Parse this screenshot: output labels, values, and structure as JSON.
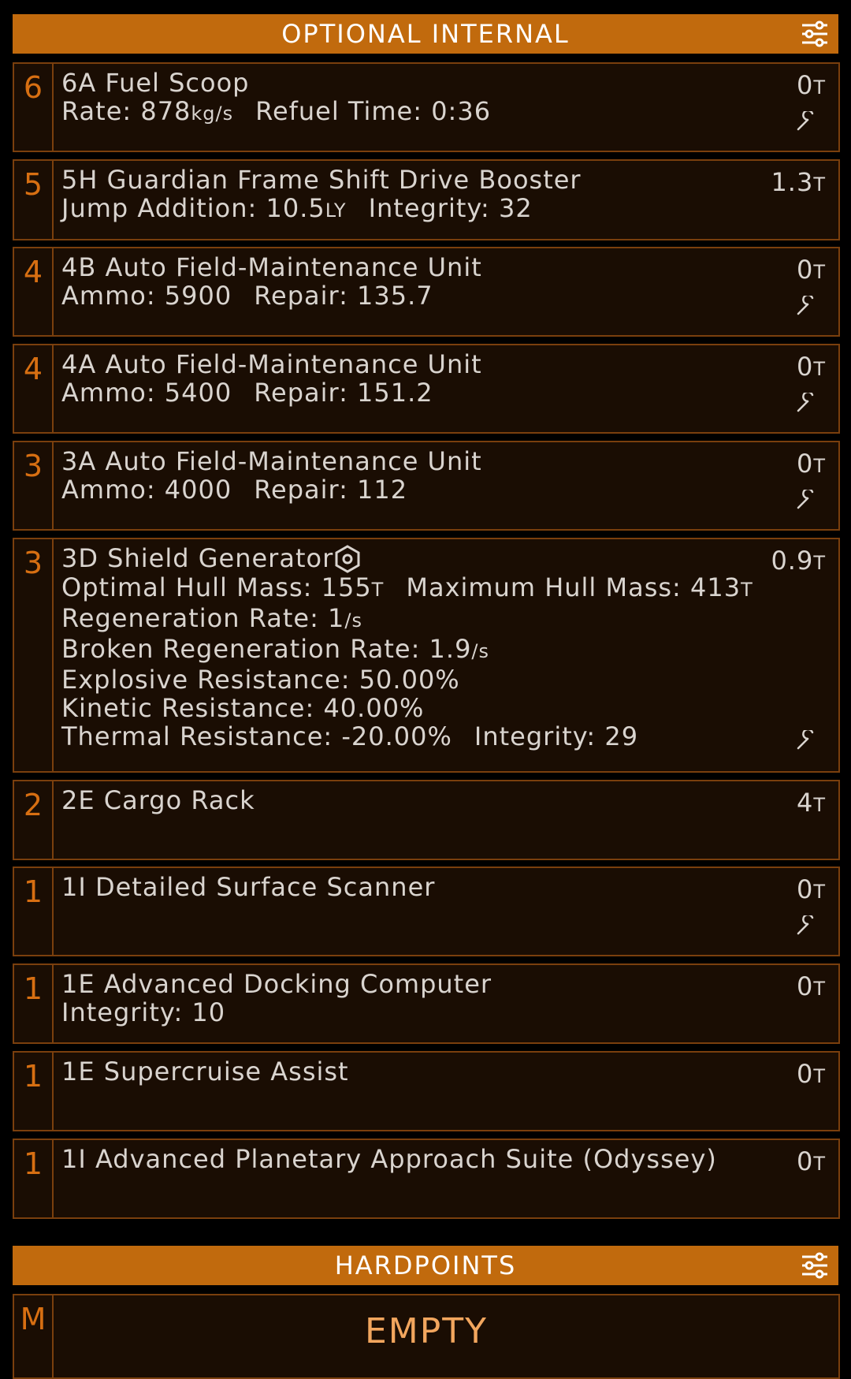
{
  "optional_internal": {
    "title": "OPTIONAL INTERNAL",
    "filter_icon": "sliders-icon",
    "slots": [
      {
        "size": "6",
        "name": "6A Fuel Scoop",
        "mass": "0",
        "mass_unit": "T",
        "stat1_label": "Rate: ",
        "stat1_value": "878",
        "stat1_unit": "kg/s",
        "stat2": "Refuel Time: 0:36",
        "wrench": true
      },
      {
        "size": "5",
        "name": "5H Guardian Frame Shift Drive Booster",
        "mass": "1.3",
        "mass_unit": "T",
        "stat1_label": "Jump Addition: ",
        "stat1_value": "10.5",
        "stat1_unit": "LY",
        "stat2": "Integrity: 32"
      },
      {
        "size": "4",
        "name": "4B Auto Field-Maintenance Unit",
        "mass": "0",
        "mass_unit": "T",
        "stat1_label": "Ammo: ",
        "stat1_value": "5900",
        "stat2": "Repair: 135.7",
        "wrench": true
      },
      {
        "size": "4",
        "name": "4A Auto Field-Maintenance Unit",
        "mass": "0",
        "mass_unit": "T",
        "stat1_label": "Ammo: ",
        "stat1_value": "5400",
        "stat2": "Repair: 151.2",
        "wrench": true
      },
      {
        "size": "3",
        "name": "3A Auto Field-Maintenance Unit",
        "mass": "0",
        "mass_unit": "T",
        "stat1_label": "Ammo: ",
        "stat1_value": "4000",
        "stat2": "Repair: 112",
        "wrench": true
      },
      {
        "size": "3",
        "name": "3D Shield Generator",
        "mass": "0.9",
        "mass_unit": "T",
        "optimal_hull_mass": "Optimal Hull Mass: ",
        "optimal_hull_value": "155",
        "optimal_hull_unit": "T",
        "maximum_hull_mass": "Maximum Hull Mass: ",
        "maximum_hull_value": "413",
        "maximum_hull_unit": "T",
        "regen_label": "Regeneration Rate: ",
        "regen_value": "1",
        "regen_unit": "/s",
        "broken_regen_label": "Broken Regeneration Rate: ",
        "broken_regen_value": "1.9",
        "broken_regen_unit": "/s",
        "explosive": "Explosive Resistance: 50.00%",
        "kinetic": "Kinetic Resistance: 40.00%",
        "thermal": "Thermal Resistance: -20.00%",
        "integrity": "Integrity: 29",
        "wrench": true
      },
      {
        "size": "2",
        "name": "2E Cargo Rack",
        "mass": "4",
        "mass_unit": "T"
      },
      {
        "size": "1",
        "name": "1I Detailed Surface Scanner",
        "mass": "0",
        "mass_unit": "T",
        "wrench": true
      },
      {
        "size": "1",
        "name": "1E Advanced Docking Computer",
        "mass": "0",
        "mass_unit": "T",
        "stat1_label": "Integrity: 10"
      },
      {
        "size": "1",
        "name": "1E Supercruise Assist",
        "mass": "0",
        "mass_unit": "T"
      },
      {
        "size": "1",
        "name": "1I Advanced Planetary Approach Suite (Odyssey)",
        "mass": "0",
        "mass_unit": "T"
      }
    ]
  },
  "hardpoints": {
    "title": "HARDPOINTS",
    "slots": [
      {
        "size": "M",
        "label": "EMPTY"
      }
    ]
  },
  "colors": {
    "accent": "#c16a0d",
    "slot_bg": "#1a0d03",
    "slot_border": "#7a3f0d",
    "size_text": "#d76f12",
    "empty_text": "#f2a65e"
  }
}
